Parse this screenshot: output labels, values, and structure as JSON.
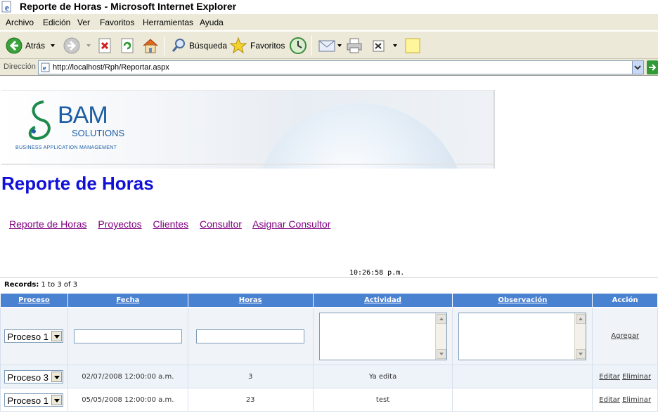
{
  "window": {
    "title": "Reporte de Horas - Microsoft Internet Explorer"
  },
  "menu": [
    "Archivo",
    "Edición",
    "Ver",
    "Favoritos",
    "Herramientas",
    "Ayuda"
  ],
  "toolbar": {
    "back": "Atrás",
    "search": "Búsqueda",
    "favorites": "Favoritos"
  },
  "address": {
    "label": "Dirección",
    "url": "http://localhost/Rph/Reportar.aspx"
  },
  "banner": {
    "logo_main": "BAM",
    "logo_sub": "SOLUTIONS",
    "tagline": "BUSINESS APPLICATION MANAGEMENT"
  },
  "page": {
    "title": "Reporte de Horas",
    "time": "10:26:58 p.m."
  },
  "nav": [
    "Reporte de Horas",
    "Proyectos",
    "Clientes",
    "Consultor",
    "Asignar Consultor"
  ],
  "records": {
    "label": "Records:",
    "text": "1 to 3 of 3"
  },
  "grid": {
    "headers": [
      "Proceso",
      "Fecha",
      "Horas",
      "Actividad",
      "Observación",
      "Acción"
    ],
    "new_row": {
      "proceso": "Proceso 1",
      "action": "Agregar"
    },
    "rows": [
      {
        "proceso": "Proceso 3",
        "fecha": "02/07/2008 12:00:00 a.m.",
        "horas": "3",
        "actividad": "Ya edita",
        "observacion": "",
        "edit": "Editar",
        "delete": "Eliminar"
      },
      {
        "proceso": "Proceso 1",
        "fecha": "05/05/2008 12:00:00 a.m.",
        "horas": "23",
        "actividad": "test",
        "observacion": "",
        "edit": "Editar",
        "delete": "Eliminar"
      }
    ]
  }
}
